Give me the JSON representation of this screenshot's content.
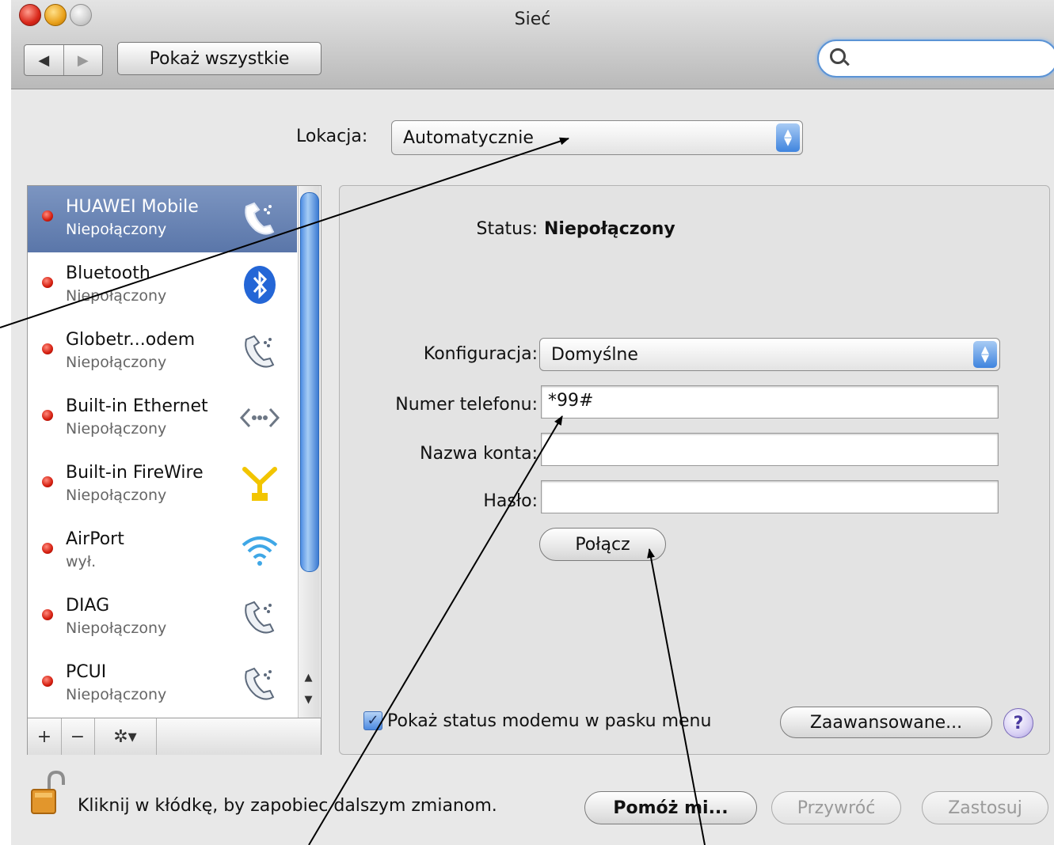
{
  "window": {
    "title": "Sieć"
  },
  "toolbar": {
    "back": "◀",
    "forward": "▶",
    "show_all": "Pokaż wszystkie",
    "search_placeholder": ""
  },
  "location": {
    "label": "Lokacja:",
    "value": "Automatycznie"
  },
  "services": [
    {
      "name": "HUAWEI Mobile",
      "status": "Niepołączony",
      "icon": "phone-modem-icon",
      "selected": true
    },
    {
      "name": "Bluetooth",
      "status": "Niepołączony",
      "icon": "bluetooth-icon"
    },
    {
      "name": "Globetr...odem",
      "status": "Niepołączony",
      "icon": "phone-modem-icon"
    },
    {
      "name": "Built-in Ethernet",
      "status": "Niepołączony",
      "icon": "ethernet-icon"
    },
    {
      "name": "Built-in FireWire",
      "status": "Niepołączony",
      "icon": "firewire-icon"
    },
    {
      "name": "AirPort",
      "status": "wył.",
      "icon": "wifi-icon"
    },
    {
      "name": "DIAG",
      "status": "Niepołączony",
      "icon": "phone-modem-icon"
    },
    {
      "name": "PCUI",
      "status": "Niepołączony",
      "icon": "phone-modem-icon"
    }
  ],
  "sidebar_buttons": {
    "add": "+",
    "remove": "−",
    "gear": "✲▾"
  },
  "detail": {
    "status_label": "Status:",
    "status_value": "Niepołączony",
    "config_label": "Konfiguracja:",
    "config_value": "Domyślne",
    "phone_label": "Numer telefonu:",
    "phone_value": "*99#",
    "account_label": "Nazwa konta:",
    "account_value": "",
    "password_label": "Hasło:",
    "password_value": "",
    "connect_button": "Połącz",
    "show_status_checkbox": "Pokaż status modemu w pasku menu",
    "show_status_checked": true,
    "advanced_button": "Zaawansowane...",
    "help_button": "?"
  },
  "footer": {
    "lock_text": "Kliknij w kłódkę, by zapobiec dalszym zmianom.",
    "assist_button": "Pomóż mi...",
    "revert_button": "Przywróć",
    "apply_button": "Zastosuj"
  },
  "colors": {
    "selection": "#6a84b5",
    "status_red": "#d41d0e",
    "accent_blue": "#3f84de"
  }
}
